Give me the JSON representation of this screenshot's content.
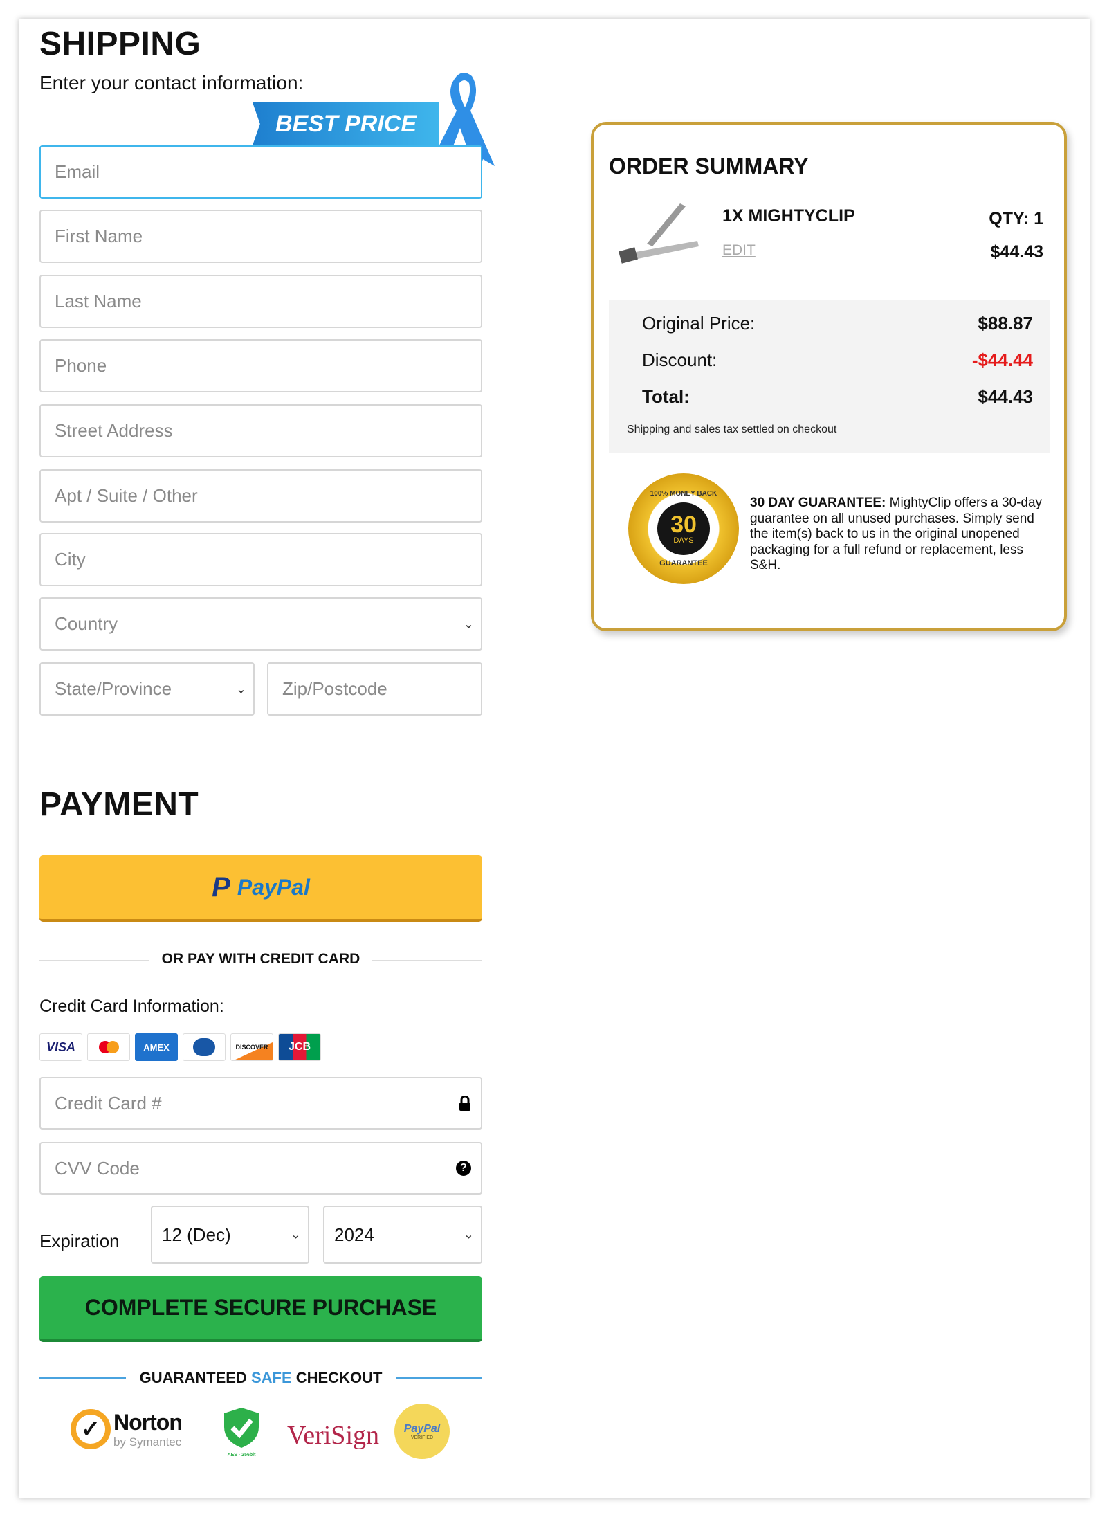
{
  "shipping": {
    "title": "SHIPPING",
    "subtitle": "Enter your contact information:",
    "badge": "BEST PRICE",
    "fields": {
      "email": "Email",
      "first_name": "First Name",
      "last_name": "Last Name",
      "phone": "Phone",
      "street": "Street Address",
      "apt": "Apt / Suite / Other",
      "city": "City",
      "country": "Country",
      "state": "State/Province",
      "zip": "Zip/Postcode"
    }
  },
  "payment": {
    "title": "PAYMENT",
    "paypal_label": "PayPal",
    "or_text": "OR PAY WITH CREDIT CARD",
    "cc_info": "Credit Card Information:",
    "card_logos": [
      "VISA",
      "mastercard",
      "AMEX",
      "Diners",
      "DISCOVER",
      "JCB"
    ],
    "cc_placeholder": "Credit Card #",
    "cvv_placeholder": "CVV Code",
    "expiration_label": "Expiration",
    "exp_month": "12 (Dec)",
    "exp_year": "2024",
    "submit": "COMPLETE SECURE PURCHASE",
    "safe": {
      "pre": "GUARANTEED ",
      "highlight": "SAFE",
      "post": " CHECKOUT"
    },
    "trust": {
      "norton": "Norton",
      "norton_sub": "by Symantec",
      "aes": "AES - 256bit",
      "verisign": "VeriSign",
      "paypal": "PayPal",
      "paypal_sub": "VERIFIED"
    }
  },
  "summary": {
    "title": "ORDER SUMMARY",
    "product": "1X MIGHTYCLIP",
    "qty": "QTY: 1",
    "edit": "EDIT",
    "price": "$44.43",
    "original_label": "Original Price:",
    "original": "$88.87",
    "discount_label": "Discount:",
    "discount": "-$44.44",
    "total_label": "Total:",
    "total": "$44.43",
    "note": "Shipping and sales tax settled on checkout",
    "seal": {
      "top": "100% MONEY BACK",
      "num": "30",
      "days": "DAYS",
      "bottom": "GUARANTEE"
    },
    "guarantee_title": "30 DAY GUARANTEE:",
    "guarantee_text": "MightyClip offers a 30-day guarantee on all unused purchases. Simply send the item(s) back to us in the original unopened packaging for a full refund or replacement, less S&H."
  },
  "colors": {
    "accent_blue": "#3fb6ec",
    "gold": "#c9a03a",
    "paypal_yellow": "#fcc033",
    "green": "#2bb24c",
    "discount_red": "#e51b1b"
  }
}
